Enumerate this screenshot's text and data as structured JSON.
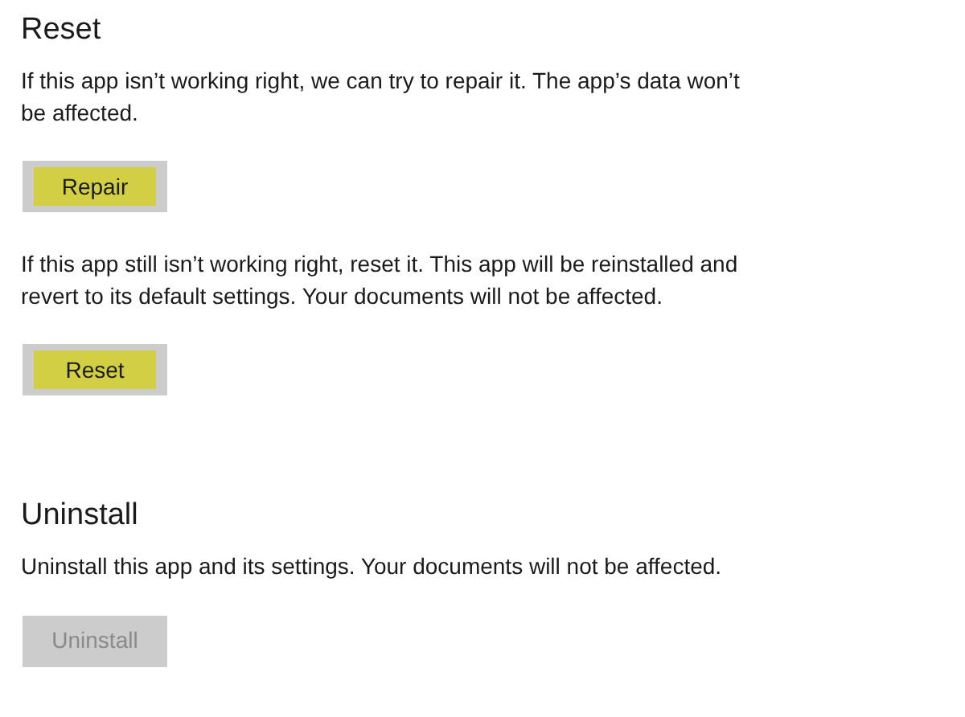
{
  "sections": [
    {
      "heading": "Reset",
      "items": [
        {
          "kind": "text",
          "text": "If this app isn’t working right, we can try to repair it. The app’s data won’t be affected."
        },
        {
          "kind": "button",
          "label": "Repair",
          "disabled": false,
          "highlighted": true
        },
        {
          "kind": "text",
          "text": "If this app still isn’t working right, reset it. This app will be reinstalled and revert to its default settings. Your documents will not be affected."
        },
        {
          "kind": "button",
          "label": "Reset",
          "disabled": false,
          "highlighted": true
        }
      ]
    },
    {
      "heading": "Uninstall",
      "items": [
        {
          "kind": "text",
          "text": "Uninstall this app and its settings. Your documents will not be affected."
        },
        {
          "kind": "button",
          "label": "Uninstall",
          "disabled": true,
          "highlighted": false
        }
      ]
    }
  ]
}
